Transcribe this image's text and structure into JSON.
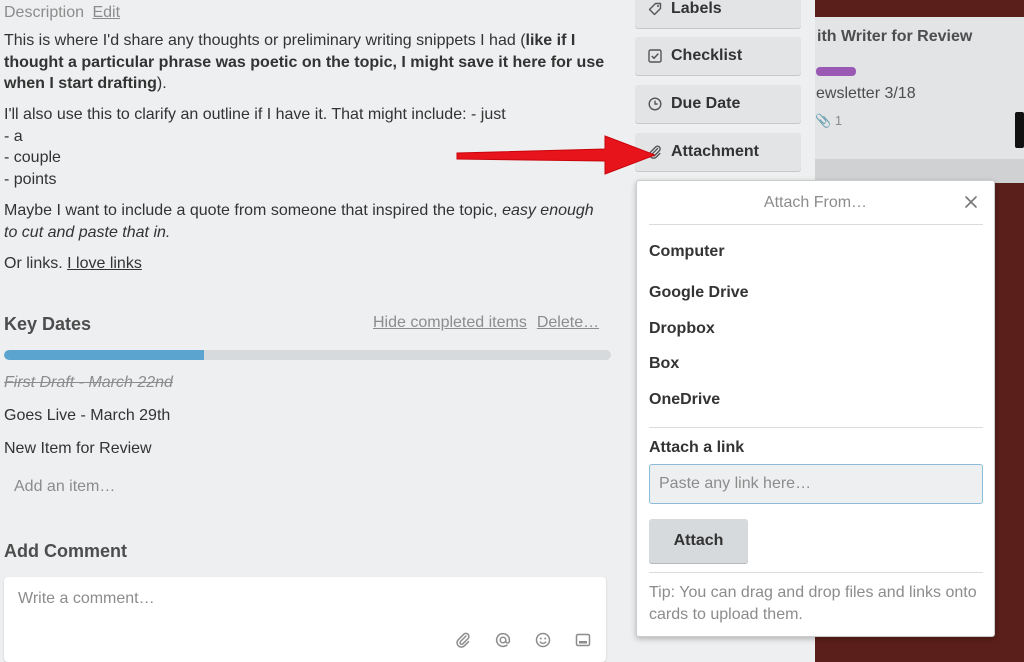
{
  "description": {
    "heading": "Description",
    "edit_label": "Edit",
    "para1_plain": "This is where I'd share any thoughts or preliminary writing snippets I had (",
    "para1_bold": "like if I thought a particular phrase was poetic on the topic, I might save it here for use when I start drafting",
    "para1_end": ").",
    "para2_line1": "I'll also use this to clarify an outline if I have it. That might include: - just",
    "para2_line2": "- a",
    "para2_line3": "- couple",
    "para2_line4": "- points",
    "para3_plain": "Maybe I want to include a quote from someone that inspired the topic, ",
    "para3_italic": "easy enough to cut and paste that in.",
    "para4_plain": "Or links. ",
    "para4_link": "I love links"
  },
  "key_dates": {
    "title": "Key Dates",
    "hide_completed": "Hide completed items",
    "delete": "Delete…",
    "progress": 0.33,
    "items": [
      {
        "label": "First Draft - March 22nd",
        "done": true
      },
      {
        "label": "Goes Live - March 29th",
        "done": false
      },
      {
        "label": "New Item for Review",
        "done": false
      }
    ],
    "add_item": "Add an item…"
  },
  "comment": {
    "title": "Add Comment",
    "placeholder": "Write a comment…",
    "tools": [
      "paperclip-icon",
      "at-icon",
      "emoji-icon",
      "card-icon"
    ]
  },
  "sidebar": {
    "buttons": [
      {
        "label": "Labels",
        "icon": "tag-icon"
      },
      {
        "label": "Checklist",
        "icon": "checkbox-icon"
      },
      {
        "label": "Due Date",
        "icon": "clock-icon"
      },
      {
        "label": "Attachment",
        "icon": "paperclip-icon"
      }
    ]
  },
  "board": {
    "card_title": "ith Writer for Review",
    "card_text": "ewsletter 3/18",
    "card_meta": "1",
    "label_color": "#9b59b6"
  },
  "popover": {
    "title": "Attach From…",
    "sources": [
      "Computer",
      "Google Drive",
      "Dropbox",
      "Box",
      "OneDrive"
    ],
    "link_label": "Attach a link",
    "link_placeholder": "Paste any link here…",
    "attach_button": "Attach",
    "tip": "Tip: You can drag and drop files and links onto cards to upload them."
  },
  "colors": {
    "arrow": "#e8141b",
    "progress": "#5ba4cf",
    "board_bg": "#5a1f1a"
  }
}
